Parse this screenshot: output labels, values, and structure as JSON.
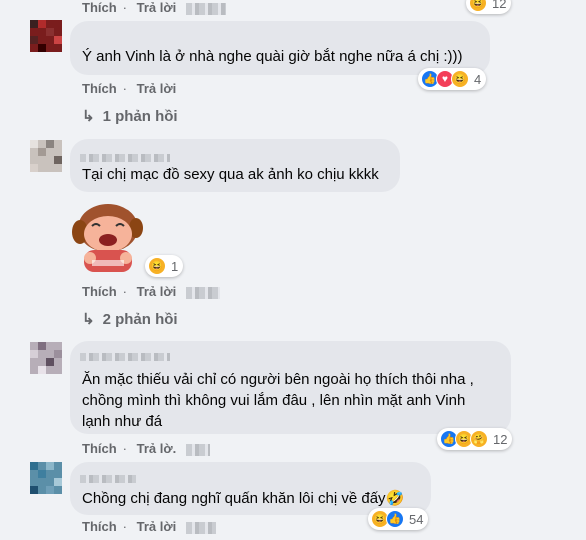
{
  "top_actions": {
    "like": "Thích",
    "reply": "Trả lời",
    "count": "12"
  },
  "comments": [
    {
      "text": "Ý anh Vinh là ở nhà nghe quài giờ bắt nghe nữa á chị :)))",
      "like": "Thích",
      "reply": "Trả lời",
      "reactions": {
        "icons": [
          "like-icon",
          "love-icon",
          "haha-icon"
        ],
        "count": "4"
      },
      "replies": "1 phản hồi"
    },
    {
      "text": "Tại chị mạc đồ sexy qua ak ảnh ko chịu kkkk",
      "sticker": "sticker-girl",
      "like": "Thích",
      "reply": "Trả lời",
      "reactions": {
        "icons": [
          "haha-icon"
        ],
        "count": "1"
      },
      "replies": "2 phản hồi"
    },
    {
      "text": "Ăn mặc thiếu vải chỉ có người bên ngoài họ thích thôi nha ,\nchồng mình thì không vui lắm đâu , lên nhìn mặt anh Vinh\nlạnh như đá",
      "like": "Thích",
      "reply": "Trả lờ.",
      "reactions": {
        "icons": [
          "like-icon",
          "haha-icon",
          "care-icon"
        ],
        "count": "12"
      }
    },
    {
      "text": "Chồng chị đang nghĩ quấn khăn lôi chị về đấy🤣",
      "like": "Thích",
      "reply": "Trả lời",
      "reactions": {
        "icons": [
          "haha-icon",
          "like-icon"
        ],
        "count": "54"
      }
    }
  ],
  "colors": {
    "background": "#f0f2f5",
    "bubble": "#e4e6eb",
    "like": "#1877f2",
    "love": "#f33e58",
    "haha": "#f7b125"
  }
}
